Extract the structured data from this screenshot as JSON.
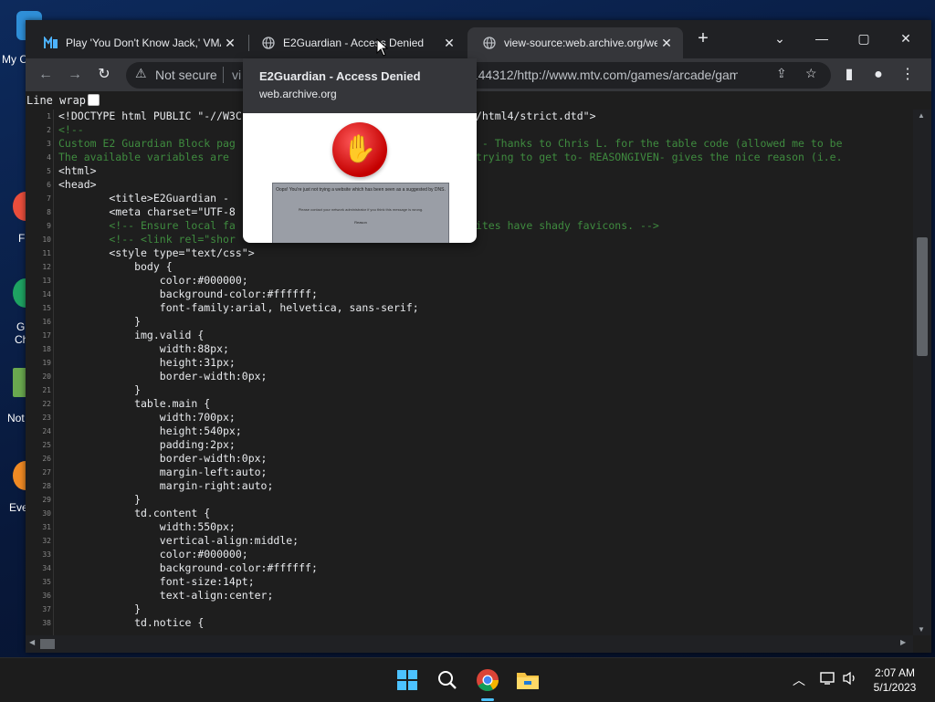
{
  "desktop": {
    "icons": [
      {
        "label": "My C",
        "color": "#2f8fd8"
      },
      {
        "label": "F",
        "color": "#e94e3c"
      },
      {
        "label": "G",
        "sublabel": "Ch",
        "color": "#1ea362"
      },
      {
        "label": "Not",
        "color": "#6aa84f"
      },
      {
        "label": "Eve",
        "color": "#f08a24"
      }
    ]
  },
  "browser": {
    "tabs": [
      {
        "title": "Play 'You Don't Know Jack,' VMA",
        "favicon": "mtv-icon",
        "close": "✕"
      },
      {
        "title": "E2Guardian - Access Denied",
        "favicon": "globe-icon",
        "close": "✕"
      },
      {
        "title": "view-source:web.archive.org/we",
        "favicon": "globe-icon",
        "close": "✕"
      }
    ],
    "new_tab": "+",
    "window": {
      "dropdown": "⌄",
      "minimize": "—",
      "maximize": "▢",
      "close": "✕"
    },
    "toolbar": {
      "not_secure": "Not secure",
      "url_prefix": "vi",
      "url_tail": "0144312/http://www.mtv.com/games/arcade/gam..."
    },
    "hover_card": {
      "title": "E2Guardian - Access Denied",
      "domain": "web.archive.org",
      "preview_text": "Oops! You're just not trying a website which has been seen as a suggested by DNS.",
      "preview_sub": "Please contact your network administrator if you think this message is wrong.",
      "preview_reason": "Reason"
    },
    "line_wrap_label": "Line wrap",
    "source_lines": [
      {
        "n": "1",
        "text": "<!DOCTYPE html PUBLIC \"-//W3C                              .org/TR/html4/strict.dtd\">",
        "kind": "tag"
      },
      {
        "n": "2",
        "text": "<!--",
        "kind": "comment"
      },
      {
        "n": "3",
        "text": "Custom E2 Guardian Block pag                              - V1.0.2 - Thanks to Chris L. for the table code (allowed me to be",
        "kind": "comment"
      },
      {
        "n": "4",
        "text": "The available variables are                              user was trying to get to- REASONGIVEN- gives the nice reason (i.e.",
        "kind": "comment"
      },
      {
        "n": "5",
        "text": "<html>",
        "kind": "tag"
      },
      {
        "n": "6",
        "text": "<head>",
        "kind": "tag"
      },
      {
        "n": "7",
        "text": "        <title>E2Guardian - ",
        "kind": "tag"
      },
      {
        "n": "8",
        "text": "        <meta charset=\"UTF-8",
        "kind": "tag"
      },
      {
        "n": "9",
        "text": "        <!-- Ensure local fa                              , some sites have shady favicons. -->",
        "kind": "comment"
      },
      {
        "n": "10",
        "text": "        <!-- <link rel=\"shor",
        "kind": "comment"
      },
      {
        "n": "11",
        "text": "        <style type=\"text/css\">",
        "kind": "tag"
      },
      {
        "n": "12",
        "text": "            body {",
        "kind": "tag"
      },
      {
        "n": "13",
        "text": "                color:#000000;",
        "kind": "tag"
      },
      {
        "n": "14",
        "text": "                background-color:#ffffff;",
        "kind": "tag"
      },
      {
        "n": "15",
        "text": "                font-family:arial, helvetica, sans-serif;",
        "kind": "tag"
      },
      {
        "n": "16",
        "text": "            }",
        "kind": "tag"
      },
      {
        "n": "17",
        "text": "            img.valid {",
        "kind": "tag"
      },
      {
        "n": "18",
        "text": "                width:88px;",
        "kind": "tag"
      },
      {
        "n": "19",
        "text": "                height:31px;",
        "kind": "tag"
      },
      {
        "n": "20",
        "text": "                border-width:0px;",
        "kind": "tag"
      },
      {
        "n": "21",
        "text": "            }",
        "kind": "tag"
      },
      {
        "n": "22",
        "text": "            table.main {",
        "kind": "tag"
      },
      {
        "n": "23",
        "text": "                width:700px;",
        "kind": "tag"
      },
      {
        "n": "24",
        "text": "                height:540px;",
        "kind": "tag"
      },
      {
        "n": "25",
        "text": "                padding:2px;",
        "kind": "tag"
      },
      {
        "n": "26",
        "text": "                border-width:0px;",
        "kind": "tag"
      },
      {
        "n": "27",
        "text": "                margin-left:auto;",
        "kind": "tag"
      },
      {
        "n": "28",
        "text": "                margin-right:auto;",
        "kind": "tag"
      },
      {
        "n": "29",
        "text": "            }",
        "kind": "tag"
      },
      {
        "n": "30",
        "text": "            td.content {",
        "kind": "tag"
      },
      {
        "n": "31",
        "text": "                width:550px;",
        "kind": "tag"
      },
      {
        "n": "32",
        "text": "                vertical-align:middle;",
        "kind": "tag"
      },
      {
        "n": "33",
        "text": "                color:#000000;",
        "kind": "tag"
      },
      {
        "n": "34",
        "text": "                background-color:#ffffff;",
        "kind": "tag"
      },
      {
        "n": "35",
        "text": "                font-size:14pt;",
        "kind": "tag"
      },
      {
        "n": "36",
        "text": "                text-align:center;",
        "kind": "tag"
      },
      {
        "n": "37",
        "text": "            }",
        "kind": "tag"
      },
      {
        "n": "38",
        "text": "            td.notice {",
        "kind": "tag"
      }
    ]
  },
  "taskbar": {
    "apps": [
      "start-icon",
      "search-icon",
      "chrome-icon",
      "file-explorer-icon"
    ],
    "tray_chevron": "︿",
    "time": "2:07 AM",
    "date": "5/1/2023"
  },
  "colors": {
    "accent": "#8ab4f8",
    "comment": "#3f8b3f",
    "code_text": "#e8eaed"
  }
}
